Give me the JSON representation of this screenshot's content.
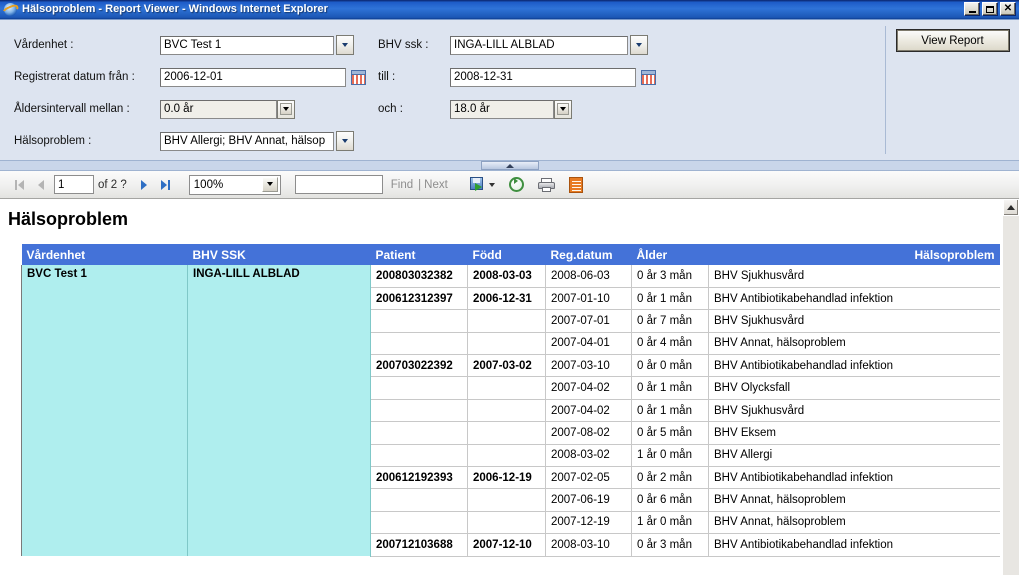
{
  "window": {
    "title": "Hälsoproblem - Report Viewer - Windows Internet Explorer",
    "logo_icon": "internet-explorer-icon",
    "minimize_label": "",
    "maximize_label": "",
    "close_label": "✕"
  },
  "parameters": {
    "vardenhet_label": "Vårdenhet :",
    "vardenhet_value": "BVC Test 1",
    "bhv_ssk_label": "BHV ssk :",
    "bhv_ssk_value": "INGA-LILL ALBLAD",
    "datum_fran_label": "Registrerat datum från :",
    "datum_fran_value": "2006-12-01",
    "till_label": "till :",
    "till_value": "2008-12-31",
    "aldersintervall_label": "Åldersintervall mellan :",
    "aldersintervall_value": "0.0 år",
    "och_label": "och :",
    "och_value": "18.0 år",
    "halsoproblem_label": "Hälsoproblem :",
    "halsoproblem_value": "BHV Allergi; BHV Annat, hälsop",
    "view_report_label": "View Report"
  },
  "toolbar": {
    "first_page_icon": "first-page-icon",
    "prev_page_icon": "previous-page-icon",
    "page_number": "1",
    "page_total": "of 2 ?",
    "next_page_icon": "next-page-icon",
    "last_page_icon": "last-page-icon",
    "zoom_value": "100%",
    "find_value": "",
    "find_label": "Find",
    "find_separator": "|",
    "next_label": "Next",
    "export_icon": "export-save-icon",
    "refresh_icon": "refresh-icon",
    "print_icon": "print-icon",
    "report_icon": "report-document-icon"
  },
  "report": {
    "title": "Hälsoproblem",
    "columns": [
      "Vårdenhet",
      "BHV SSK",
      "Patient",
      "Född",
      "Reg.datum",
      "Ålder",
      "Hälsoproblem"
    ],
    "group": {
      "vardenhet": "BVC Test 1",
      "bhv_ssk": "INGA-LILL ALBLAD"
    },
    "rows": [
      {
        "patient": "200803032382",
        "fodd": "2008-03-03",
        "regdatum": "2008-06-03",
        "alder": "0 år 3 mån",
        "halsoproblem": "BHV Sjukhusvård"
      },
      {
        "patient": "200612312397",
        "fodd": "2006-12-31",
        "regdatum": "2007-01-10",
        "alder": "0 år 1 mån",
        "halsoproblem": "BHV Antibiotikabehandlad infektion"
      },
      {
        "patient": "",
        "fodd": "",
        "regdatum": "2007-07-01",
        "alder": "0 år 7 mån",
        "halsoproblem": "BHV Sjukhusvård"
      },
      {
        "patient": "",
        "fodd": "",
        "regdatum": "2007-04-01",
        "alder": "0 år 4 mån",
        "halsoproblem": "BHV Annat, hälsoproblem"
      },
      {
        "patient": "200703022392",
        "fodd": "2007-03-02",
        "regdatum": "2007-03-10",
        "alder": "0 år 0 mån",
        "halsoproblem": "BHV Antibiotikabehandlad infektion"
      },
      {
        "patient": "",
        "fodd": "",
        "regdatum": "2007-04-02",
        "alder": "0 år 1 mån",
        "halsoproblem": "BHV Olycksfall"
      },
      {
        "patient": "",
        "fodd": "",
        "regdatum": "2007-04-02",
        "alder": "0 år 1 mån",
        "halsoproblem": "BHV Sjukhusvård"
      },
      {
        "patient": "",
        "fodd": "",
        "regdatum": "2007-08-02",
        "alder": "0 år 5 mån",
        "halsoproblem": "BHV Eksem"
      },
      {
        "patient": "",
        "fodd": "",
        "regdatum": "2008-03-02",
        "alder": "1 år 0 mån",
        "halsoproblem": "BHV Allergi"
      },
      {
        "patient": "200612192393",
        "fodd": "2006-12-19",
        "regdatum": "2007-02-05",
        "alder": "0 år 2 mån",
        "halsoproblem": "BHV Antibiotikabehandlad infektion"
      },
      {
        "patient": "",
        "fodd": "",
        "regdatum": "2007-06-19",
        "alder": "0 år 6 mån",
        "halsoproblem": "BHV Annat, hälsoproblem"
      },
      {
        "patient": "",
        "fodd": "",
        "regdatum": "2007-12-19",
        "alder": "1 år 0 mån",
        "halsoproblem": "BHV Annat, hälsoproblem"
      },
      {
        "patient": "200712103688",
        "fodd": "2007-12-10",
        "regdatum": "2008-03-10",
        "alder": "0 år 3 mån",
        "halsoproblem": "BHV Antibiotikabehandlad infektion"
      }
    ]
  },
  "colors": {
    "header_blue": "#4472d8",
    "group_cyan": "#afeeee",
    "panel_bg": "#dde4f0",
    "titlebar_blue": "#1e5cc8"
  }
}
